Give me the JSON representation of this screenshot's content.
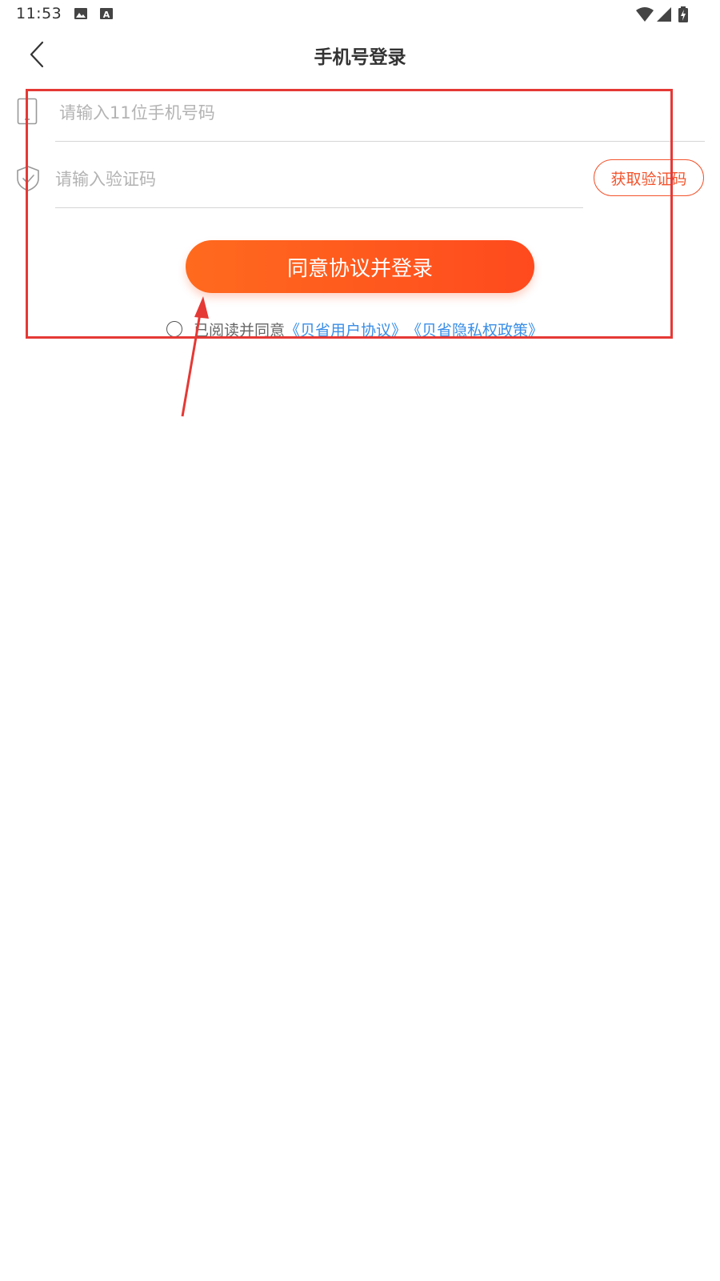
{
  "status_bar": {
    "time": "11:53",
    "icons": [
      "image-icon",
      "a-notification-icon",
      "wifi-icon",
      "signal-icon",
      "battery-charging-icon"
    ]
  },
  "header": {
    "title": "手机号登录",
    "back_icon": "chevron-left-icon"
  },
  "form": {
    "phone": {
      "icon": "phone-icon",
      "placeholder": "请输入11位手机号码",
      "value": ""
    },
    "code": {
      "icon": "shield-check-icon",
      "placeholder": "请输入验证码",
      "value": "",
      "get_code_label": "获取验证码"
    },
    "login_label": "同意协议并登录",
    "agreement": {
      "prefix": "已阅读并同意",
      "user_agreement": "《贝省用户协议》",
      "privacy_policy": "《贝省隐私权政策》",
      "checked": false
    }
  },
  "colors": {
    "accent": "#ff5a1e",
    "link": "#3a8ee6",
    "annotation": "#e53935"
  }
}
